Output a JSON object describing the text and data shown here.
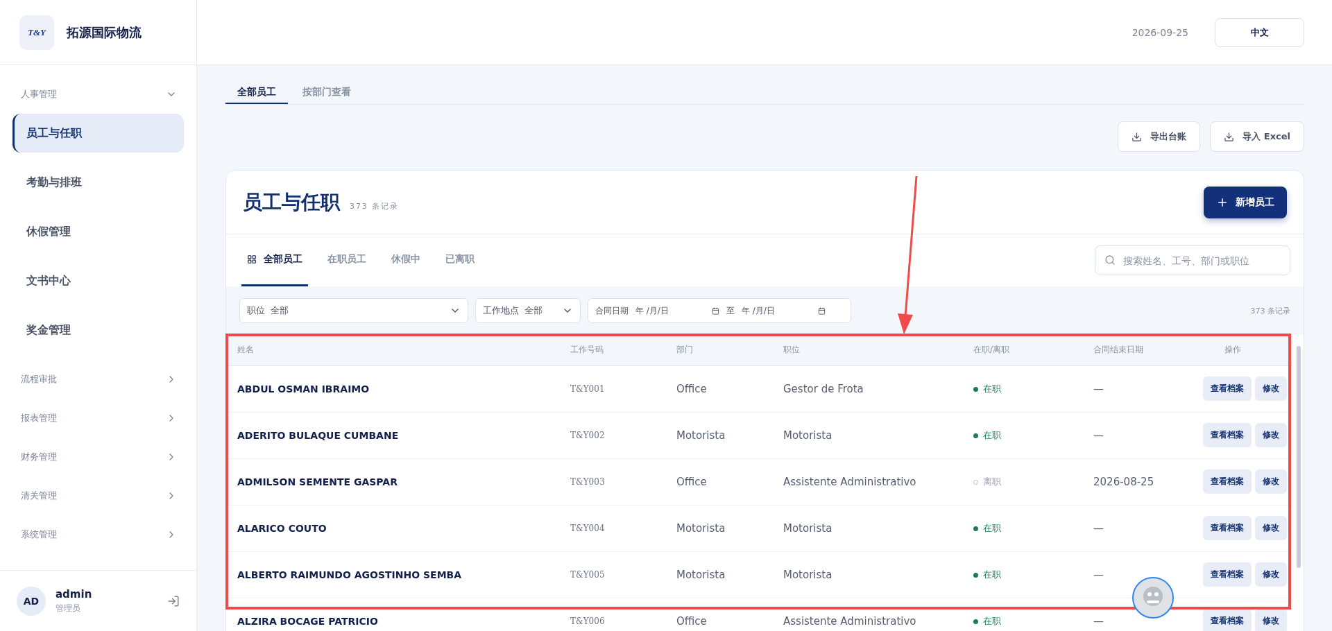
{
  "brand": {
    "name": "拓源国际物流",
    "logo_text": "T&Y"
  },
  "sidebar": {
    "groups": [
      {
        "label": "人事管理",
        "expanded": true,
        "children": [
          {
            "label": "员工与任职",
            "selected": true
          },
          {
            "label": "考勤与排班",
            "selected": false
          },
          {
            "label": "休假管理",
            "selected": false
          },
          {
            "label": "文书中心",
            "selected": false
          },
          {
            "label": "奖金管理",
            "selected": false
          }
        ]
      },
      {
        "label": "流程审批",
        "expanded": false
      },
      {
        "label": "报表管理",
        "expanded": false
      },
      {
        "label": "财务管理",
        "expanded": false
      },
      {
        "label": "清关管理",
        "expanded": false
      },
      {
        "label": "系统管理",
        "expanded": false
      }
    ],
    "user": {
      "initials": "AD",
      "name": "admin",
      "role": "管理员"
    }
  },
  "topbar": {
    "date": "2026-09-25",
    "language": "中文"
  },
  "page_tabs": [
    {
      "label": "全部员工",
      "selected": true
    },
    {
      "label": "按部门查看",
      "selected": false
    }
  ],
  "actions": [
    {
      "label": "导出台账"
    },
    {
      "label": "导入 Excel"
    }
  ],
  "card": {
    "title": "员工与任职",
    "count": "373 条记录",
    "add_button": "新增员工",
    "tabs": [
      {
        "label": "全部员工",
        "selected": true
      },
      {
        "label": "在职员工",
        "selected": false
      },
      {
        "label": "休假中",
        "selected": false
      },
      {
        "label": "已离职",
        "selected": false
      }
    ],
    "search": {
      "placeholder": "搜索姓名、工号、部门或职位"
    },
    "filters": {
      "position": {
        "label": "职位",
        "value": "全部"
      },
      "location": {
        "label": "工作地点",
        "value": "全部"
      },
      "contract": {
        "label": "合同日期",
        "from": "年 /月/日",
        "separator": "至",
        "to": "年 /月/日"
      },
      "records": "373 条记录"
    },
    "table": {
      "columns": [
        "姓名",
        "工作号码",
        "部门",
        "职位",
        "在职/离职",
        "合同结束日期",
        "操作"
      ],
      "rows": [
        {
          "name": "ABDUL OSMAN IBRAIMO",
          "id": "T&Y001",
          "department": "Office",
          "position": "Gestor de Frota",
          "status": "在职",
          "active": true,
          "contract_end": "—",
          "view": "查看档案",
          "edit": "修改"
        },
        {
          "name": "ADERITO BULAQUE CUMBANE",
          "id": "T&Y002",
          "department": "Motorista",
          "position": "Motorista",
          "status": "在职",
          "active": true,
          "contract_end": "—",
          "view": "查看档案",
          "edit": "修改"
        },
        {
          "name": "ADMILSON SEMENTE GASPAR",
          "id": "T&Y003",
          "department": "Office",
          "position": "Assistente Administrativo",
          "status": "离职",
          "active": false,
          "contract_end": "2026-08-25",
          "view": "查看档案",
          "edit": "修改"
        },
        {
          "name": "ALARICO COUTO",
          "id": "T&Y004",
          "department": "Motorista",
          "position": "Motorista",
          "status": "在职",
          "active": true,
          "contract_end": "—",
          "view": "查看档案",
          "edit": "修改"
        },
        {
          "name": "ALBERTO RAIMUNDO AGOSTINHO SEMBA",
          "id": "T&Y005",
          "department": "Motorista",
          "position": "Motorista",
          "status": "在职",
          "active": true,
          "contract_end": "—",
          "view": "查看档案",
          "edit": "修改"
        },
        {
          "name": "ALZIRA BOCAGE PATRICIO",
          "id": "T&Y006",
          "department": "Office",
          "position": "Assistente Administrativo",
          "status": "在职",
          "active": true,
          "contract_end": "—",
          "view": "查看档案",
          "edit": "修改"
        }
      ]
    }
  }
}
